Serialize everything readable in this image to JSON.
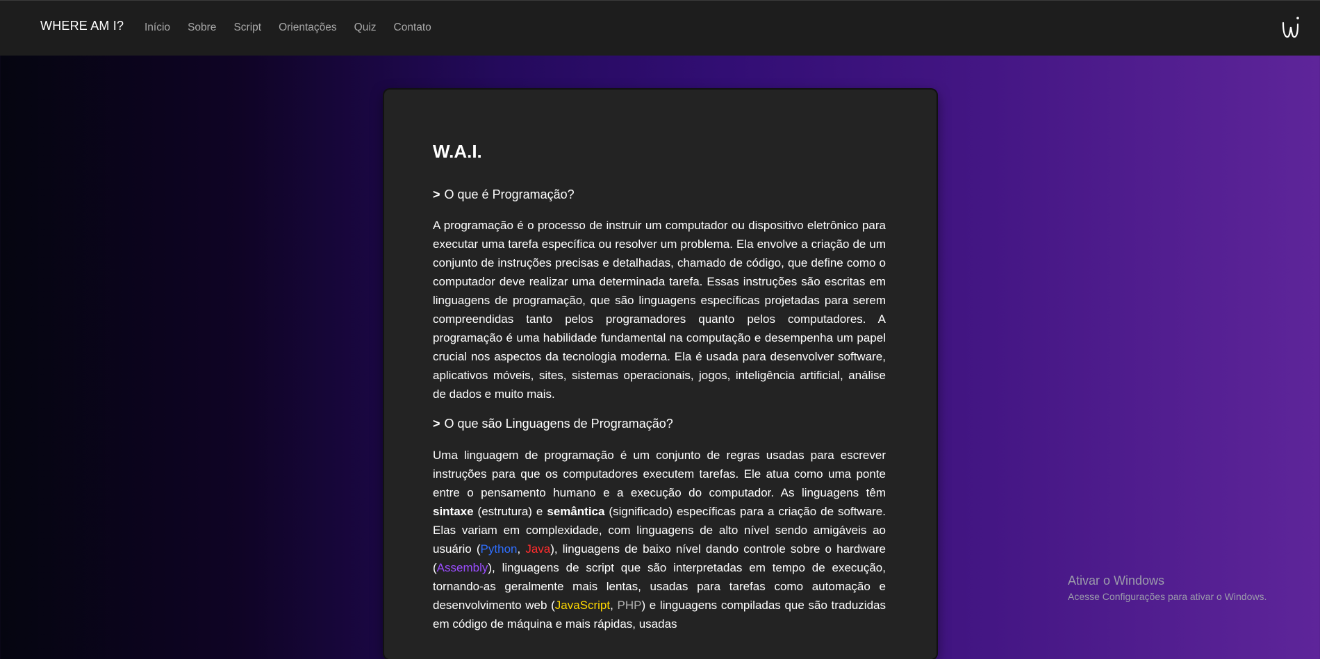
{
  "nav": {
    "brand": "WHERE AM I?",
    "links": [
      "Início",
      "Sobre",
      "Script",
      "Orientações",
      "Quiz",
      "Contato"
    ],
    "logo_icon": "wai-logo-icon"
  },
  "card": {
    "title": "W.A.I.",
    "section1": {
      "marker": ">",
      "heading": "O que é Programação?",
      "paragraph": "A programação é o processo de instruir um computador ou dispositivo eletrônico para executar uma tarefa específica ou resolver um problema. Ela envolve a criação de um conjunto de instruções precisas e detalhadas, chamado de código, que define como o computador deve realizar uma determinada tarefa. Essas instruções são escritas em linguagens de programação, que são linguagens específicas projetadas para serem compreendidas tanto pelos programadores quanto pelos computadores. A programação é uma habilidade fundamental na computação e desempenha um papel crucial nos aspectos da tecnologia moderna. Ela é usada para desenvolver software, aplicativos móveis, sites, sistemas operacionais, jogos, inteligência artificial, análise de dados e muito mais."
    },
    "section2": {
      "marker": ">",
      "heading": "O que são Linguagens de Programação?",
      "p_a": "Uma linguagem de programação é um conjunto de regras usadas para escrever instruções para que os computadores executem tarefas. Ele atua como uma ponte entre o pensamento humano e a execução do computador. As linguagens têm ",
      "term1": "sintaxe",
      "p_b": " (estrutura) e ",
      "term2": "semântica",
      "p_c": " (significado) específicas para a criação de software. Elas variam em complexidade, com linguagens de alto nível sendo amigáveis ao usuário (",
      "python": "Python",
      "sep1": ", ",
      "java": "Java",
      "p_d": "), linguagens de baixo nível dando controle sobre o hardware (",
      "assembly": "Assembly",
      "p_e": "), linguagens de script que são interpretadas em tempo de execução, tornando-as geralmente mais lentas, usadas para tarefas como automação e desenvolvimento web (",
      "javascript": "JavaScript",
      "sep2": ", ",
      "php": "PHP",
      "p_f": ") e linguagens compiladas que são traduzidas em código de máquina e mais rápidas, usadas"
    },
    "colors": {
      "python": "#2f6fff",
      "java": "#ff2d2d",
      "assembly": "#9b4dff",
      "javascript": "#ffd800",
      "php": "#b3b3b3"
    }
  },
  "watermark": {
    "title": "Ativar o Windows",
    "subtitle": "Acesse Configurações para ativar o Windows."
  }
}
